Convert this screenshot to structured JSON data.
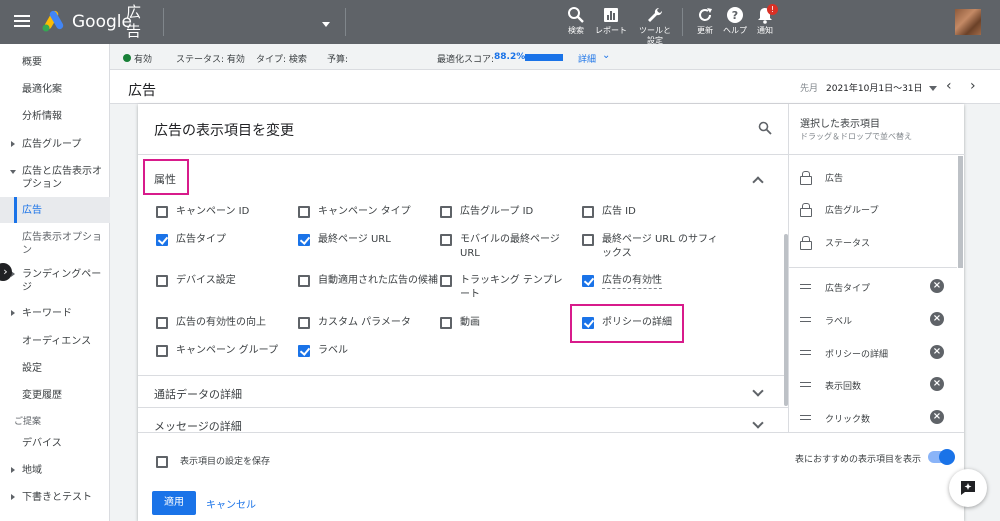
{
  "topbar": {
    "logo_text": "Google",
    "product": "広告",
    "buttons": [
      {
        "label": "検索",
        "icon": "search-icon"
      },
      {
        "label": "レポート",
        "icon": "reports-icon"
      },
      {
        "label": "ツールと\n設定",
        "icon": "wrench-icon"
      },
      {
        "label": "更新",
        "icon": "refresh-icon"
      },
      {
        "label": "ヘルプ",
        "icon": "help-icon"
      },
      {
        "label": "通知",
        "icon": "bell-icon"
      }
    ],
    "notification_count": "!"
  },
  "sidebar": {
    "items": [
      {
        "label": "概要"
      },
      {
        "label": "最適化案"
      },
      {
        "label": "分析情報"
      },
      {
        "label": "広告グループ"
      },
      {
        "label": "広告と広告表示オプション"
      },
      {
        "label": "広告"
      },
      {
        "label": "広告表示オプション"
      },
      {
        "label": "ランディングページ"
      },
      {
        "label": "キーワード"
      },
      {
        "label": "オーディエンス"
      },
      {
        "label": "設定"
      },
      {
        "label": "変更履歴"
      },
      {
        "label": "ご提案"
      },
      {
        "label": "デバイス"
      },
      {
        "label": "地域"
      },
      {
        "label": "下書きとテスト"
      }
    ]
  },
  "status": {
    "enabled": "有効",
    "status_text": "ステータス: 有効",
    "type_text": "タイプ: 検索",
    "budget": "予算:",
    "score_label": "最適化スコア:",
    "score_value": "88.2%",
    "details": "詳細"
  },
  "header": {
    "title": "広告",
    "period_label": "先月",
    "date_range": "2021年10月1日～31日"
  },
  "panel": {
    "title": "広告の表示項目を変更",
    "section_attributes": "属性",
    "section_call": "通話データの詳細",
    "section_message": "メッセージの詳細",
    "checkboxes": [
      {
        "label": "キャンペーン ID",
        "checked": false
      },
      {
        "label": "キャンペーン タイプ",
        "checked": false
      },
      {
        "label": "広告グループ ID",
        "checked": false
      },
      {
        "label": "広告 ID",
        "checked": false
      },
      {
        "label": "広告タイプ",
        "checked": true
      },
      {
        "label": "最終ページ URL",
        "checked": true
      },
      {
        "label": "モバイルの最終ページ URL",
        "checked": false
      },
      {
        "label": "最終ページ URL のサフィックス",
        "checked": false
      },
      {
        "label": "デバイス設定",
        "checked": false
      },
      {
        "label": "自動適用された広告の候補",
        "checked": false
      },
      {
        "label": "トラッキング テンプレート",
        "checked": false
      },
      {
        "label": "広告の有効性",
        "checked": true
      },
      {
        "label": "広告の有効性の向上",
        "checked": false
      },
      {
        "label": "カスタム パラメータ",
        "checked": false
      },
      {
        "label": "動画",
        "checked": false
      },
      {
        "label": "ポリシーの詳細",
        "checked": true
      },
      {
        "label": "キャンペーン グループ",
        "checked": false
      },
      {
        "label": "ラベル",
        "checked": true
      }
    ],
    "selected": {
      "title": "選択した表示項目",
      "subtitle": "ドラッグ＆ドロップで並べ替え",
      "locked": [
        "広告",
        "広告グループ",
        "ステータス"
      ],
      "movable": [
        "広告タイプ",
        "ラベル",
        "ポリシーの詳細",
        "表示回数",
        "クリック数"
      ]
    },
    "footer": {
      "save_label": "表示項目の設定を保存",
      "recommend_label": "表におすすめの表示項目を表示",
      "apply": "適用",
      "cancel": "キャンセル"
    }
  }
}
